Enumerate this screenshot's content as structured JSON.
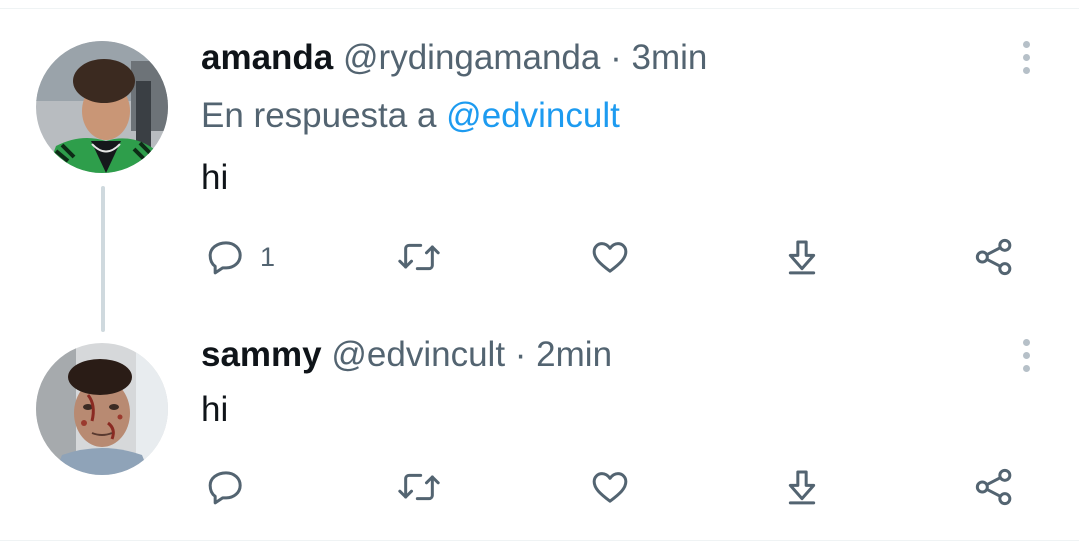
{
  "tweets": [
    {
      "name": "amanda",
      "handle": "@rydingamanda",
      "separator": "·",
      "time": "3min",
      "reply_prefix": "En respuesta a",
      "reply_mention": "@edvincult",
      "text": "hi",
      "reply_count": "1",
      "avatar_icon": "avatar-amanda"
    },
    {
      "name": "sammy",
      "handle": "@edvincult",
      "separator": "·",
      "time": "2min",
      "text": "hi",
      "reply_count": "",
      "avatar_icon": "avatar-sammy"
    }
  ],
  "icons": {
    "reply": "reply-icon",
    "retweet": "retweet-icon",
    "like": "heart-icon",
    "download": "download-icon",
    "share": "share-icon",
    "more": "more-vertical-icon"
  },
  "colors": {
    "text": "#0f1419",
    "secondary": "#536471",
    "link": "#1d9bf0",
    "thread_line": "#cfd9de",
    "divider": "#eff3f4"
  }
}
